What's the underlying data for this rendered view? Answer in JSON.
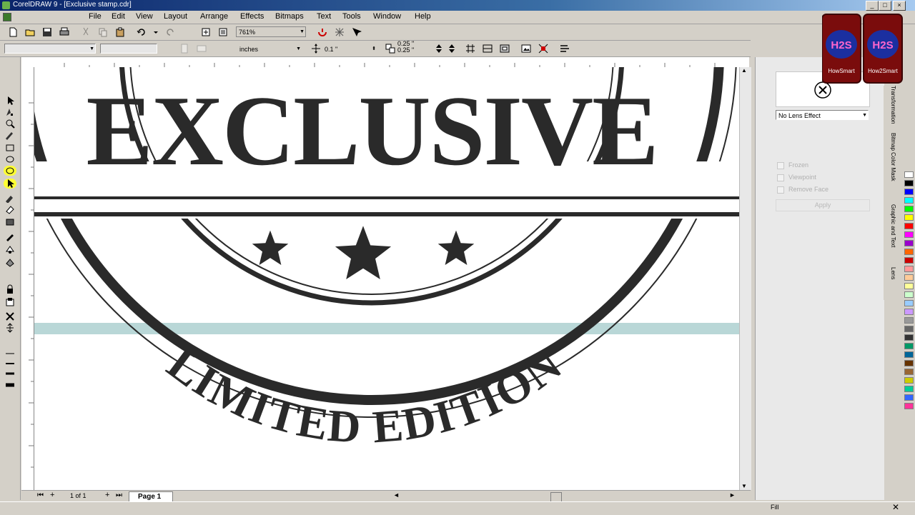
{
  "app": {
    "title": "CorelDRAW 9 - [Exclusive stamp.cdr]",
    "window_buttons": [
      "_",
      "□",
      "×"
    ]
  },
  "menu": {
    "items": [
      "File",
      "Edit",
      "View",
      "Layout",
      "Arrange",
      "Effects",
      "Bitmaps",
      "Text",
      "Tools",
      "Window",
      "Help"
    ]
  },
  "toolbar": {
    "zoom": "761%"
  },
  "properties": {
    "units": "inches",
    "nudge": "0.1 \"",
    "duplicate_x": "0.25 \"",
    "duplicate_y": "0.25 \""
  },
  "artwork": {
    "headline": "EXCLUSIVE",
    "arc_text": "LIMITED EDITION",
    "ink_color": "#2a2a2a",
    "accent_band": "#b9d7d7"
  },
  "lens_docker": {
    "effect": "No Lens Effect",
    "options": [
      "Frozen",
      "Viewpoint",
      "Remove Face"
    ],
    "apply_label": "Apply"
  },
  "docker_tabs": [
    "Transformation",
    "Bitmap Color Mask",
    "Graphic and Text",
    "Lens"
  ],
  "page_nav": {
    "counter": "1 of 1",
    "page_tab": "Page 1"
  },
  "status": {
    "fill_label": "Fill"
  },
  "watermark": {
    "text_left": "H2S",
    "text_right": "H2S",
    "sub_left": "HowSmart",
    "sub_right": "How2Smart"
  },
  "palette": [
    "#ffffff",
    "#000000",
    "#0000ff",
    "#00ffff",
    "#00ff00",
    "#ffff00",
    "#ff0000",
    "#ff00ff",
    "#9900cc",
    "#ff6600",
    "#cc0000",
    "#ff9999",
    "#ffcc99",
    "#ffff99",
    "#ccffcc",
    "#99ccff",
    "#cc99ff",
    "#999999",
    "#666666",
    "#333333",
    "#009966",
    "#006699",
    "#663300",
    "#996633",
    "#cccc00",
    "#00cc99",
    "#3366ff",
    "#ff3399"
  ]
}
